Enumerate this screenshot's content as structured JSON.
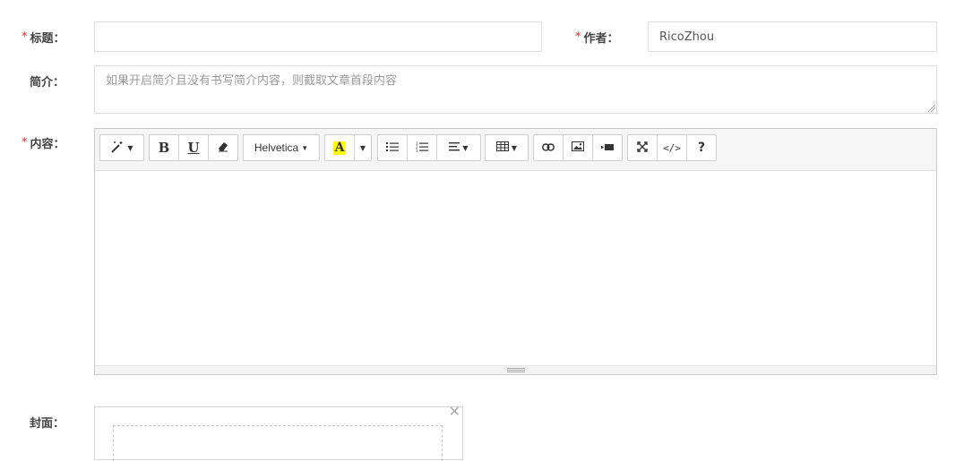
{
  "form": {
    "title": {
      "required_mark": "*",
      "label": "标题：",
      "value": "",
      "placeholder": ""
    },
    "author": {
      "required_mark": "*",
      "label": "作者：",
      "value": "RicoZhou"
    },
    "summary": {
      "label": "简介：",
      "value": "",
      "placeholder": "如果开启简介且没有书写简介内容，则截取文章首段内容"
    },
    "content": {
      "required_mark": "*",
      "label": "内容："
    },
    "cover": {
      "label": "封面：",
      "close_glyph": "✕"
    }
  },
  "editor": {
    "toolbar": {
      "style_icon": "magic-wand-icon",
      "bold_label": "B",
      "underline_label": "U",
      "eraser_icon": "eraser-icon",
      "font_name": "Helvetica",
      "color_label": "A",
      "color_highlight": "#ffff00",
      "unordered_list_icon": "unordered-list-icon",
      "ordered_list_icon": "ordered-list-icon",
      "align_icon": "align-left-icon",
      "table_icon": "table-icon",
      "link_icon": "link-icon",
      "image_icon": "image-icon",
      "video_icon": "video-icon",
      "fullscreen_icon": "fullscreen-icon",
      "codeview_label": "</>",
      "help_label": "?"
    }
  },
  "colors": {
    "required": "#e2231a",
    "toolbar_bg": "#f5f5f5",
    "border": "#dcdcdc"
  }
}
